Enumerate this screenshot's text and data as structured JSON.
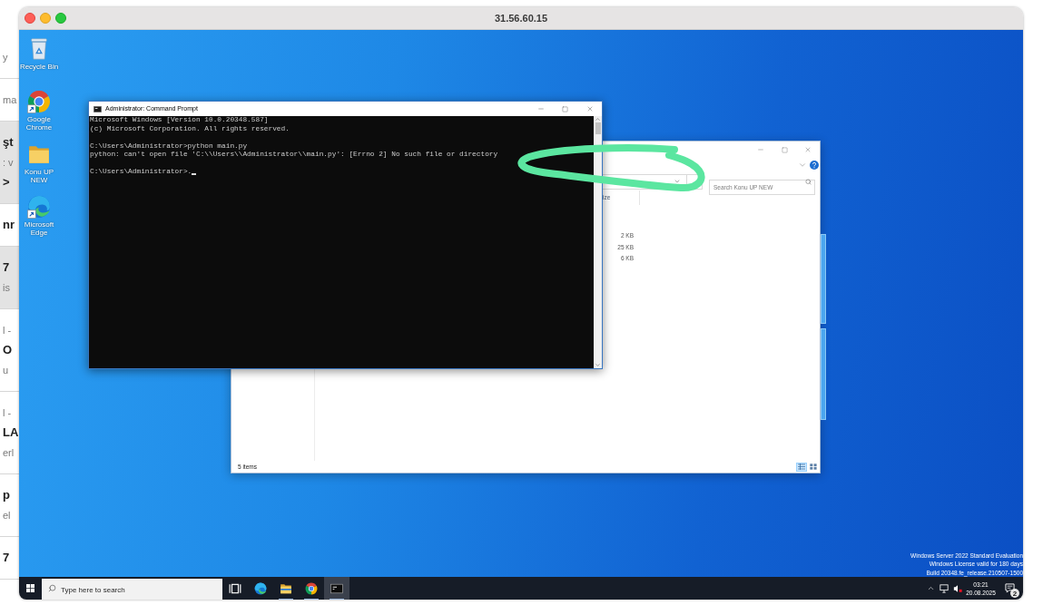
{
  "mac_window": {
    "title": "31.56.60.15"
  },
  "background_page": {
    "cards": [
      {
        "shaded": false,
        "lines": [
          {
            "text": "y",
            "kind": "muted"
          }
        ]
      },
      {
        "shaded": false,
        "lines": [
          {
            "text": "ma",
            "kind": "muted"
          }
        ]
      },
      {
        "shaded": true,
        "lines": [
          {
            "text": "şt",
            "kind": "heading"
          },
          {
            "text": ": v",
            "kind": "muted"
          },
          {
            "text": ">",
            "kind": "heading"
          }
        ]
      },
      {
        "shaded": false,
        "lines": [
          {
            "text": "nr",
            "kind": "heading"
          }
        ]
      },
      {
        "shaded": true,
        "lines": [
          {
            "text": "7",
            "kind": "heading"
          },
          {
            "text": "is",
            "kind": "muted"
          }
        ]
      },
      {
        "shaded": false,
        "lines": [
          {
            "text": "l -",
            "kind": "muted"
          },
          {
            "text": "O",
            "kind": "heading"
          },
          {
            "text": "u",
            "kind": "muted"
          }
        ]
      },
      {
        "shaded": false,
        "lines": [
          {
            "text": "l -",
            "kind": "muted"
          },
          {
            "text": "LA",
            "kind": "heading"
          },
          {
            "text": "erl",
            "kind": "muted"
          }
        ]
      },
      {
        "shaded": false,
        "lines": [
          {
            "text": "p",
            "kind": "heading"
          },
          {
            "text": "el",
            "kind": "muted"
          }
        ]
      },
      {
        "shaded": false,
        "lines": [
          {
            "text": "7",
            "kind": "heading"
          }
        ]
      }
    ]
  },
  "desktop": {
    "icons": [
      {
        "label": "Recycle Bin",
        "kind": "recycle-bin"
      },
      {
        "label": "Google Chrome",
        "kind": "chrome"
      },
      {
        "label": "Konu UP NEW",
        "kind": "folder"
      },
      {
        "label": "Microsoft Edge",
        "kind": "edge"
      }
    ],
    "notice": [
      "Windows Server 2022 Standard Evaluation",
      "Windows License valid for 180 days",
      "Build 20348.fe_release.210507-1500"
    ]
  },
  "command_prompt": {
    "title": "Administrator: Command Prompt",
    "output_groups": [
      [
        "Microsoft Windows [Version 10.0.20348.587]",
        "(c) Microsoft Corporation. All rights reserved."
      ],
      [
        "C:\\Users\\Administrator>python main.py",
        "python: can't open file 'C:\\\\Users\\\\Administrator\\\\main.py': [Errno 2] No such file or directory"
      ]
    ],
    "prompt": "C:\\Users\\Administrator>."
  },
  "explorer": {
    "search": {
      "placeholder": "Search Konu UP NEW"
    },
    "columns": [
      {
        "label": "ize"
      }
    ],
    "rows": [
      {
        "size": "2 KB"
      },
      {
        "size": "25 KB"
      },
      {
        "size": "6 KB"
      }
    ],
    "status": "5 items",
    "views": [
      {
        "kind": "details",
        "selected": true
      },
      {
        "kind": "large-icons",
        "selected": false
      }
    ]
  },
  "taskbar": {
    "search": {
      "placeholder": "Type here to search"
    },
    "buttons": [
      {
        "kind": "task-view",
        "running": false,
        "selected": false
      },
      {
        "kind": "edge",
        "running": false,
        "selected": false
      },
      {
        "kind": "folder",
        "running": true,
        "selected": false
      },
      {
        "kind": "chrome",
        "running": true,
        "selected": false
      },
      {
        "kind": "terminal",
        "running": true,
        "selected": true
      }
    ],
    "tray": {
      "time": "03:21",
      "date": "20.08.2025",
      "notification_count": "2"
    }
  }
}
